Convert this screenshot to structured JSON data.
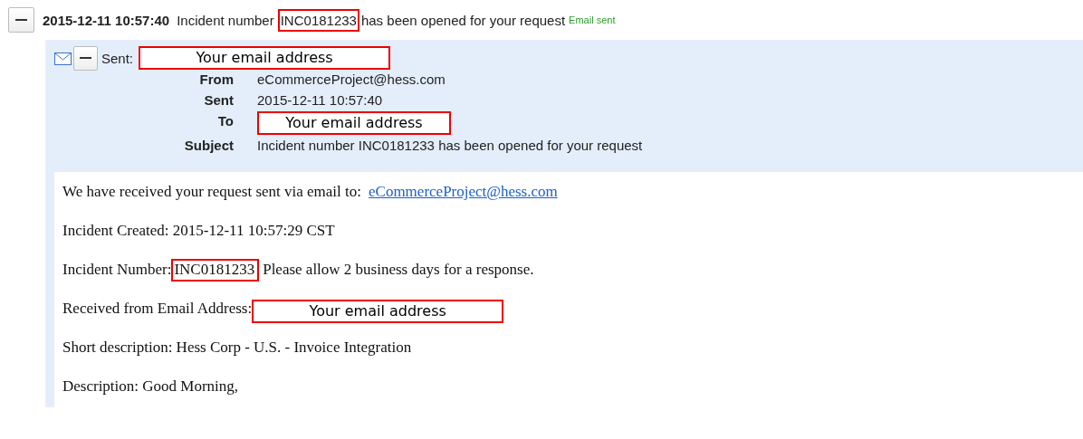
{
  "entry": {
    "timestamp": "2015-12-11 10:57:40",
    "title_prefix": "Incident number",
    "title_mark": "INC0181233",
    "title_suffix": "has been opened for your request",
    "status": "Email sent"
  },
  "email": {
    "sent_label": "Sent:",
    "sent_to": "Your email address",
    "fields": [
      {
        "label": "From",
        "value": "eCommerceProject@hess.com",
        "kind": "text"
      },
      {
        "label": "Sent",
        "value": "2015-12-11 10:57:40",
        "kind": "text"
      },
      {
        "label": "To",
        "value": "Your email address",
        "kind": "annotation"
      },
      {
        "label": "Subject",
        "value": "Incident number INC0181233 has been opened for your request",
        "kind": "text"
      }
    ]
  },
  "body": [
    {
      "kind": "link",
      "text": "We have received your request sent via email to:",
      "link": "eCommerceProject@hess.com"
    },
    {
      "kind": "plain",
      "text": "Incident Created: 2015-12-11 10:57:29 CST"
    },
    {
      "kind": "highlight",
      "text": "Incident Number:",
      "mark": "INC0181233",
      "after": "Please allow 2 business days for a response."
    },
    {
      "kind": "annotation",
      "text": "Received from Email Address:",
      "mark": "Your email address"
    },
    {
      "kind": "plain",
      "text": "Short description: Hess Corp - U.S. - Invoice Integration"
    },
    {
      "kind": "plain",
      "text": "Description: Good Morning,"
    }
  ]
}
